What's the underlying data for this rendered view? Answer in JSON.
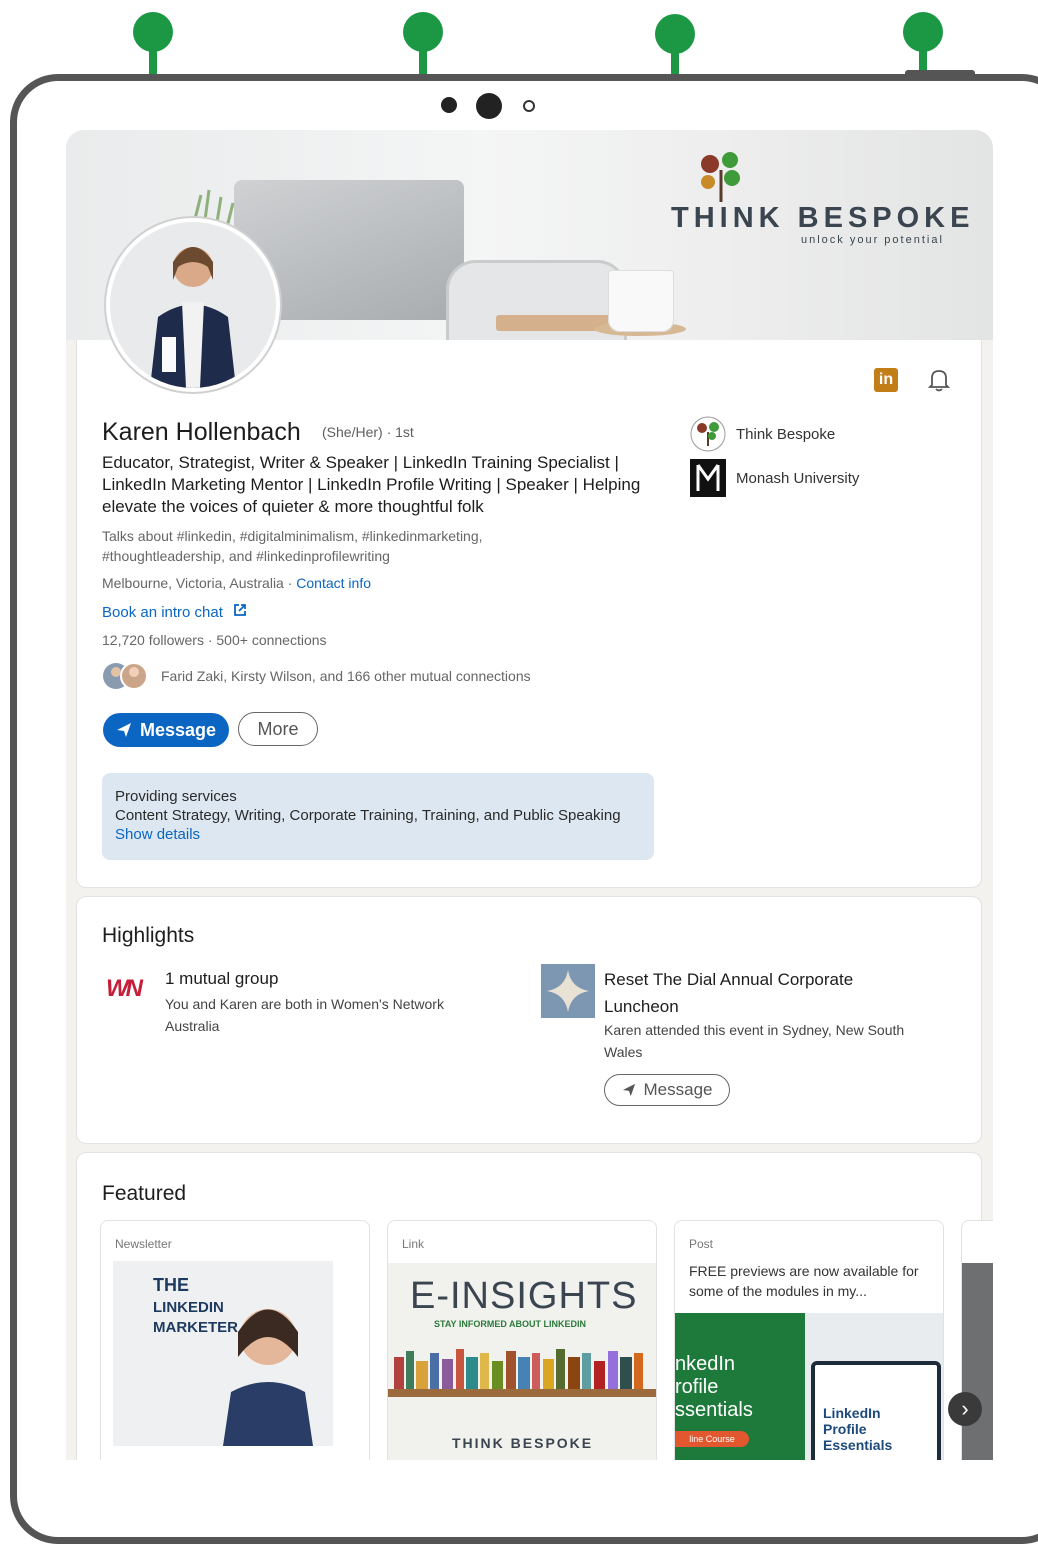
{
  "banner": {
    "brand_name": "THINK BESPOKE",
    "brand_tagline": "unlock your potential"
  },
  "profile": {
    "name": "Karen Hollenbach",
    "pronouns_degree": "(She/Her) · 1st",
    "headline": "Educator, Strategist, Writer & Speaker | LinkedIn Training Specialist | LinkedIn Marketing Mentor | LinkedIn Profile Writing | Speaker | Helping elevate the voices of quieter & more thoughtful folk",
    "talks_about": "Talks about #linkedin, #digitalminimalism, #linkedinmarketing, #thoughtleadership, and #linkedinprofilewriting",
    "location": "Melbourne, Victoria, Australia ·",
    "contact_info": "Contact info",
    "intro_link": "Book an intro chat",
    "followers": "12,720 followers  · 500+ connections",
    "mutual": "Farid Zaki, Kirsty Wilson, and 166 other mutual connections",
    "message_button": "Message",
    "more_button": "More",
    "services_title": "Providing services",
    "services_list": "Content Strategy, Writing, Corporate Training, Training, and Public Speaking",
    "services_link": "Show details",
    "orgs": [
      "Think Bespoke",
      "Monash University"
    ],
    "linkedin_badge": "in"
  },
  "highlights": {
    "title": "Highlights",
    "group_logo": "WN",
    "group_title": "1 mutual group",
    "group_desc": "You and Karen are both in Women's Network Australia",
    "event_title": "Reset The Dial Annual Corporate Luncheon",
    "event_desc": "Karen attended this event in Sydney, New South Wales",
    "event_button": "Message"
  },
  "featured": {
    "title": "Featured",
    "cards": [
      {
        "type": "Newsletter",
        "img_line1": "THE",
        "img_line2": "LINKEDIN",
        "img_line3": "MARKETER"
      },
      {
        "type": "Link",
        "img_title": "E-INSIGHTS",
        "img_sub": "STAY INFORMED ABOUT LINKEDIN",
        "img_brand": "THINK BESPOKE"
      },
      {
        "type": "Post",
        "text": "FREE previews are now available for some of the modules in my...",
        "img_title1": "nkedIn",
        "img_title2": "rofile",
        "img_title3": "ssentials",
        "img_badge": "line Course",
        "img_box": "LinkedIn Profile Essentials"
      }
    ]
  },
  "colors": {
    "accent": "#0a66c2",
    "annotation": "#1c9845",
    "linkedin_badge": "#c37d16"
  }
}
